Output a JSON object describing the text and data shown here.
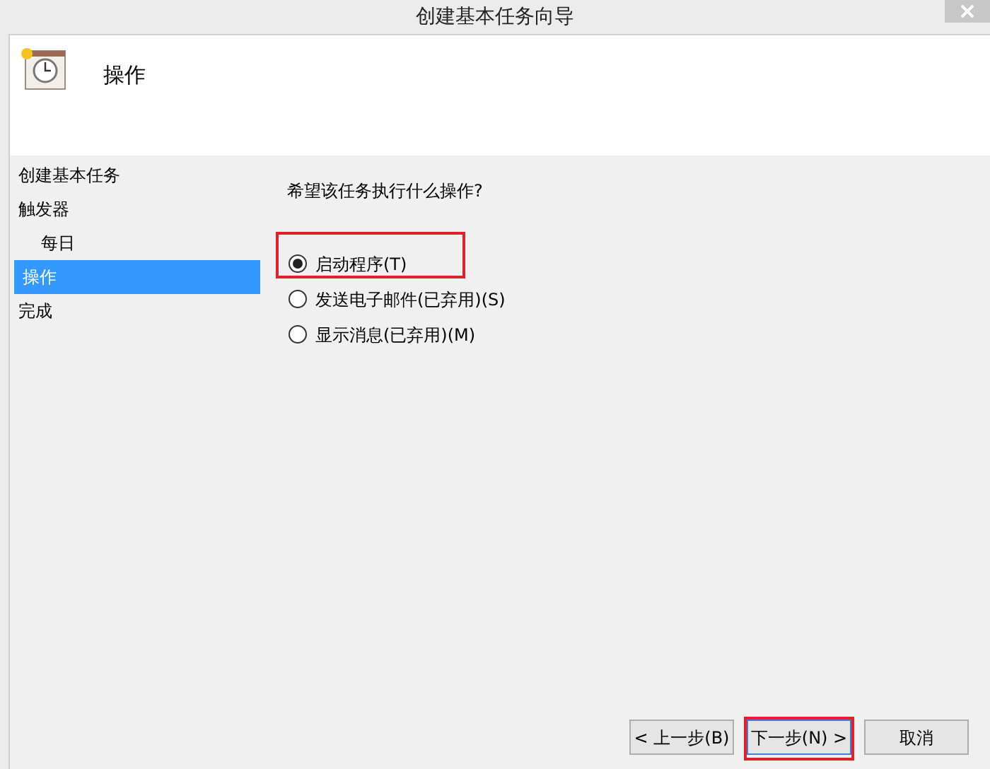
{
  "window": {
    "title": "创建基本任务向导"
  },
  "header": {
    "title": "操作"
  },
  "sidebar": {
    "items": [
      {
        "label": "创建基本任务",
        "selected": false
      },
      {
        "label": "触发器",
        "selected": false,
        "children": [
          {
            "label": "每日",
            "selected": false
          }
        ]
      },
      {
        "label": "操作",
        "selected": true
      },
      {
        "label": "完成",
        "selected": false
      }
    ]
  },
  "question": "希望该任务执行什么操作?",
  "options": [
    {
      "label": "启动程序(T)",
      "selected": true,
      "highlighted": true
    },
    {
      "label": "发送电子邮件(已弃用)(S)",
      "selected": false,
      "highlighted": false
    },
    {
      "label": "显示消息(已弃用)(M)",
      "selected": false,
      "highlighted": false
    }
  ],
  "buttons": [
    {
      "label": "< 上一步(B)",
      "highlighted": false
    },
    {
      "label": "下一步(N) >",
      "highlighted": true
    },
    {
      "label": "取消",
      "highlighted": false
    }
  ]
}
